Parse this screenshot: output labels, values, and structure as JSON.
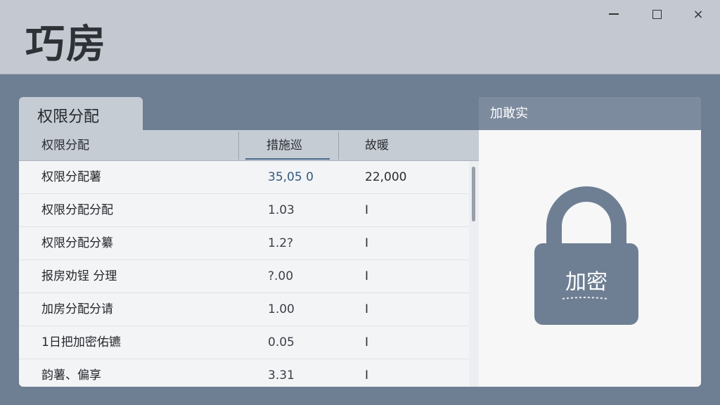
{
  "app": {
    "title": "巧房"
  },
  "window_controls": {
    "minimize": "minimize",
    "maximize": "maximize",
    "close": "×"
  },
  "left_panel": {
    "tab_label": "权限分配",
    "columns": [
      "权限分配",
      "措施巡",
      "故暖"
    ],
    "rows": [
      {
        "name": "权限分配薯",
        "value": "35,05 0",
        "extra": "22,000"
      },
      {
        "name": "权限分配分配",
        "value": "1.03",
        "extra": "I"
      },
      {
        "name": "权限分配分纂",
        "value": "1.2?",
        "extra": "I"
      },
      {
        "name": "报房劝锃 分理",
        "value": "?.00",
        "extra": "I"
      },
      {
        "name": "加房分配分请",
        "value": "1.00",
        "extra": "I"
      },
      {
        "name": "1日把加密佑镳",
        "value": "0.05",
        "extra": "I"
      },
      {
        "name": "韵薯、偏享",
        "value": "3.31",
        "extra": "I"
      }
    ]
  },
  "right_panel": {
    "header": "加敢实",
    "lock_label": "加密",
    "lock_color": "#6f7f93"
  }
}
